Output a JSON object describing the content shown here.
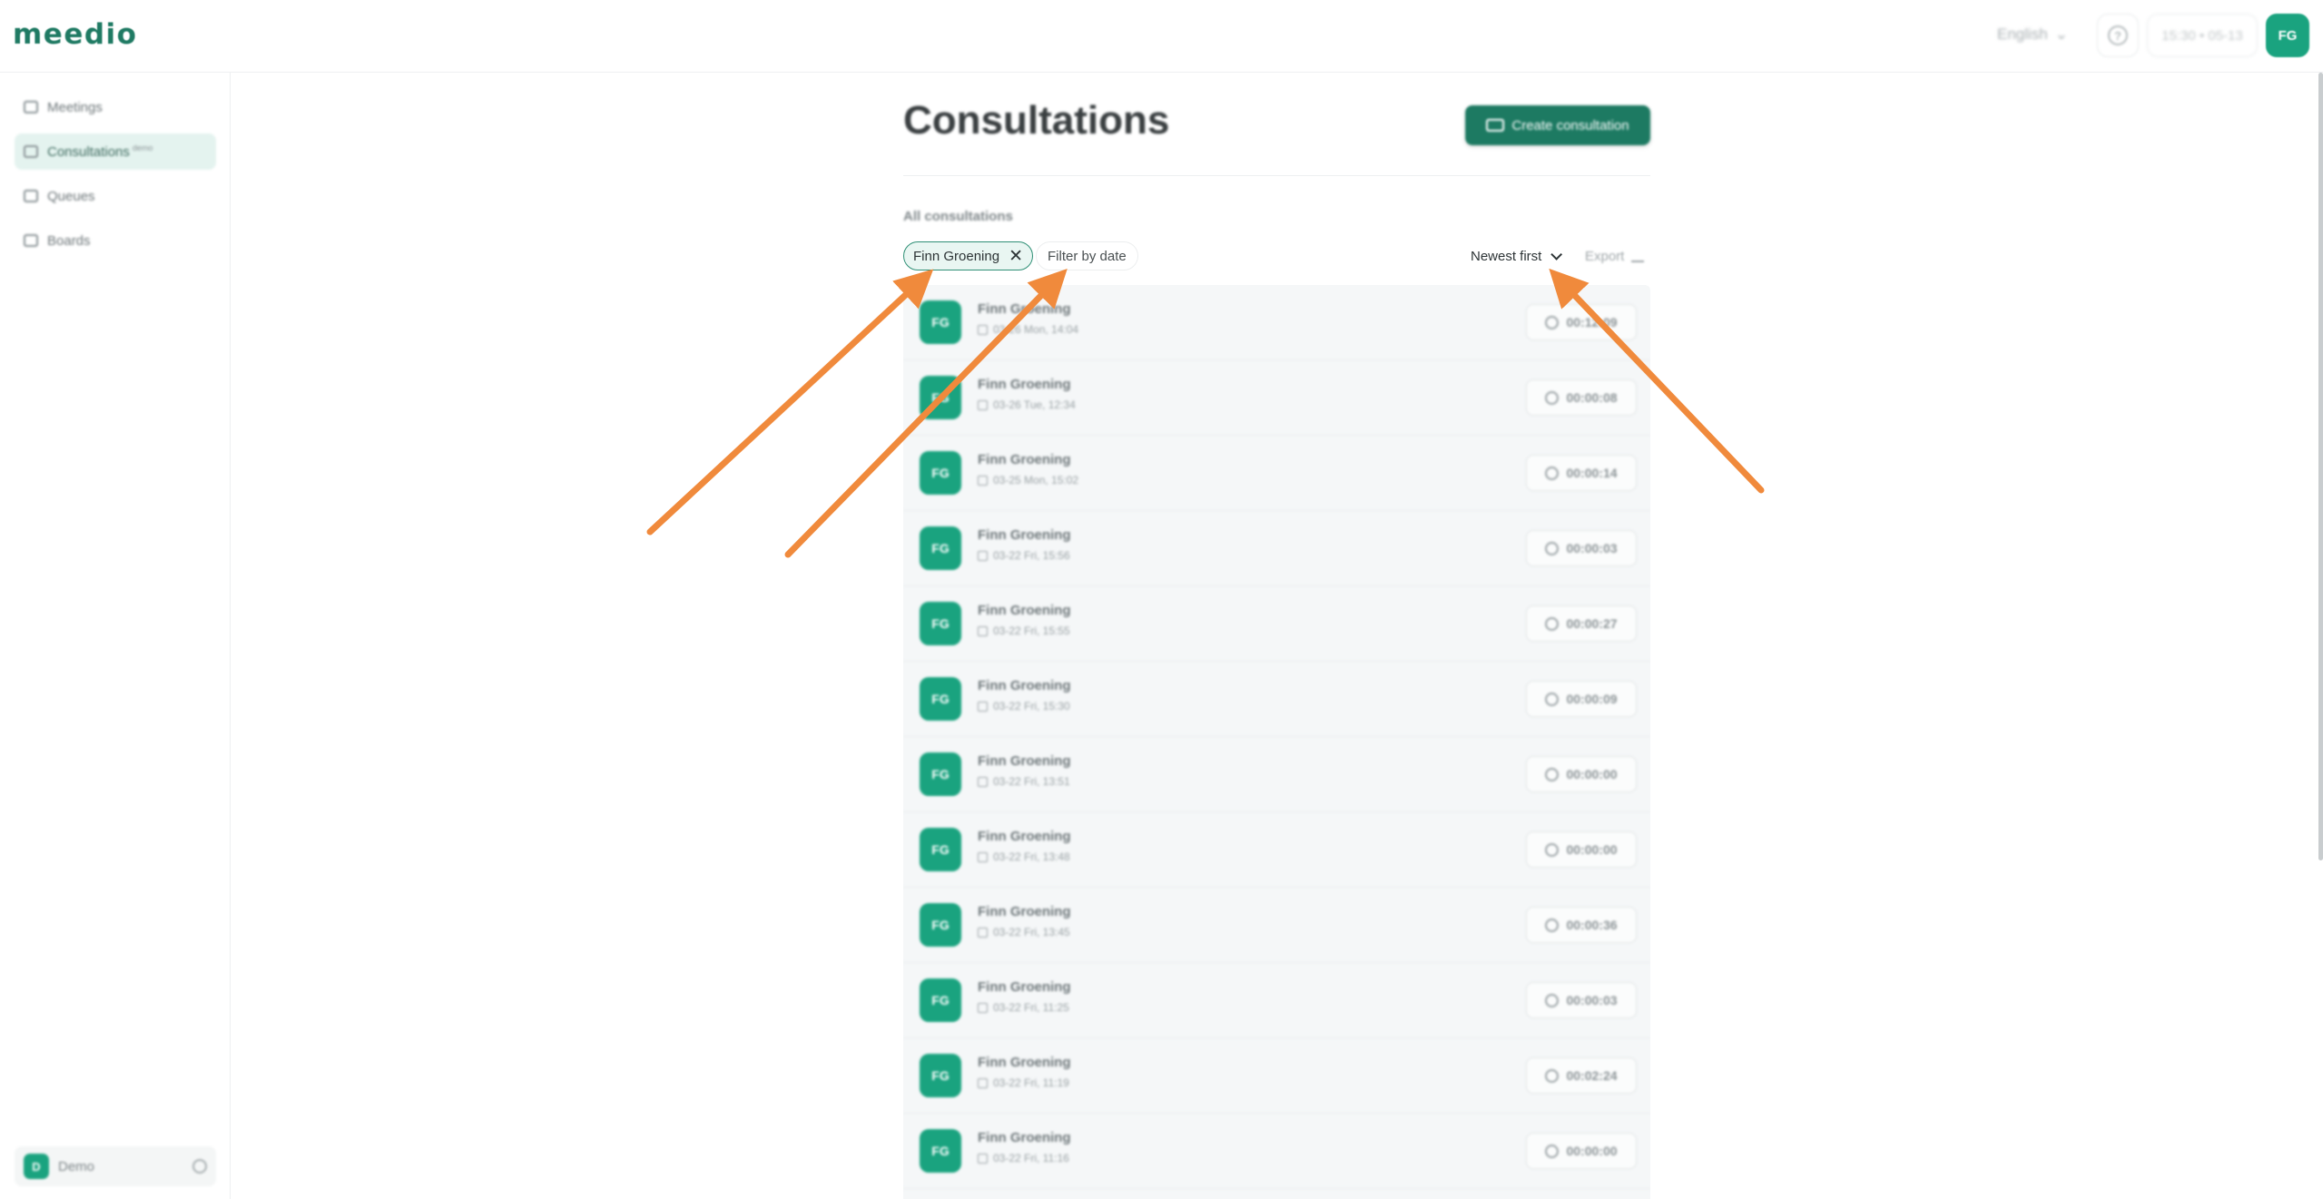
{
  "header": {
    "logo": "meedio",
    "language": "English",
    "help_symbol": "?",
    "time_status": "15:30 • 05-13",
    "user_initials": "FG"
  },
  "sidebar": {
    "items": [
      {
        "label": "Meetings",
        "icon": "video-icon",
        "active": false
      },
      {
        "label": "Consultations",
        "badge": "demo",
        "icon": "consultation-icon",
        "active": true
      },
      {
        "label": "Queues",
        "icon": "queue-icon",
        "active": false
      },
      {
        "label": "Boards",
        "icon": "board-icon",
        "active": false
      }
    ],
    "workspace": {
      "initial": "D",
      "label": "Demo"
    }
  },
  "main": {
    "title": "Consultations",
    "create_button": "Create consultation",
    "section_label": "All consultations",
    "filter_chip": "Finn Groening",
    "filter_chip_remove": "✕",
    "filter_date": "Filter by date",
    "sort": "Newest first",
    "export": "Export",
    "rows": [
      {
        "initials": "FG",
        "name": "Finn Groening",
        "date": "03-26 Mon, 14:04",
        "duration": "00:12:09"
      },
      {
        "initials": "FG",
        "name": "Finn Groening",
        "date": "03-26 Tue, 12:34",
        "duration": "00:00:08"
      },
      {
        "initials": "FG",
        "name": "Finn Groening",
        "date": "03-25 Mon, 15:02",
        "duration": "00:00:14"
      },
      {
        "initials": "FG",
        "name": "Finn Groening",
        "date": "03-22 Fri, 15:56",
        "duration": "00:00:03"
      },
      {
        "initials": "FG",
        "name": "Finn Groening",
        "date": "03-22 Fri, 15:55",
        "duration": "00:00:27"
      },
      {
        "initials": "FG",
        "name": "Finn Groening",
        "date": "03-22 Fri, 15:30",
        "duration": "00:00:09"
      },
      {
        "initials": "FG",
        "name": "Finn Groening",
        "date": "03-22 Fri, 13:51",
        "duration": "00:00:00"
      },
      {
        "initials": "FG",
        "name": "Finn Groening",
        "date": "03-22 Fri, 13:48",
        "duration": "00:00:00"
      },
      {
        "initials": "FG",
        "name": "Finn Groening",
        "date": "03-22 Fri, 13:45",
        "duration": "00:00:36"
      },
      {
        "initials": "FG",
        "name": "Finn Groening",
        "date": "03-22 Fri, 11:25",
        "duration": "00:00:03"
      },
      {
        "initials": "FG",
        "name": "Finn Groening",
        "date": "03-22 Fri, 11:19",
        "duration": "00:02:24"
      },
      {
        "initials": "FG",
        "name": "Finn Groening",
        "date": "03-22 Fri, 11:16",
        "duration": "00:00:00"
      }
    ]
  },
  "colors": {
    "brand": "#1d7a62",
    "avatar": "#1aa37f",
    "annotation_arrow": "#f08a3c"
  }
}
